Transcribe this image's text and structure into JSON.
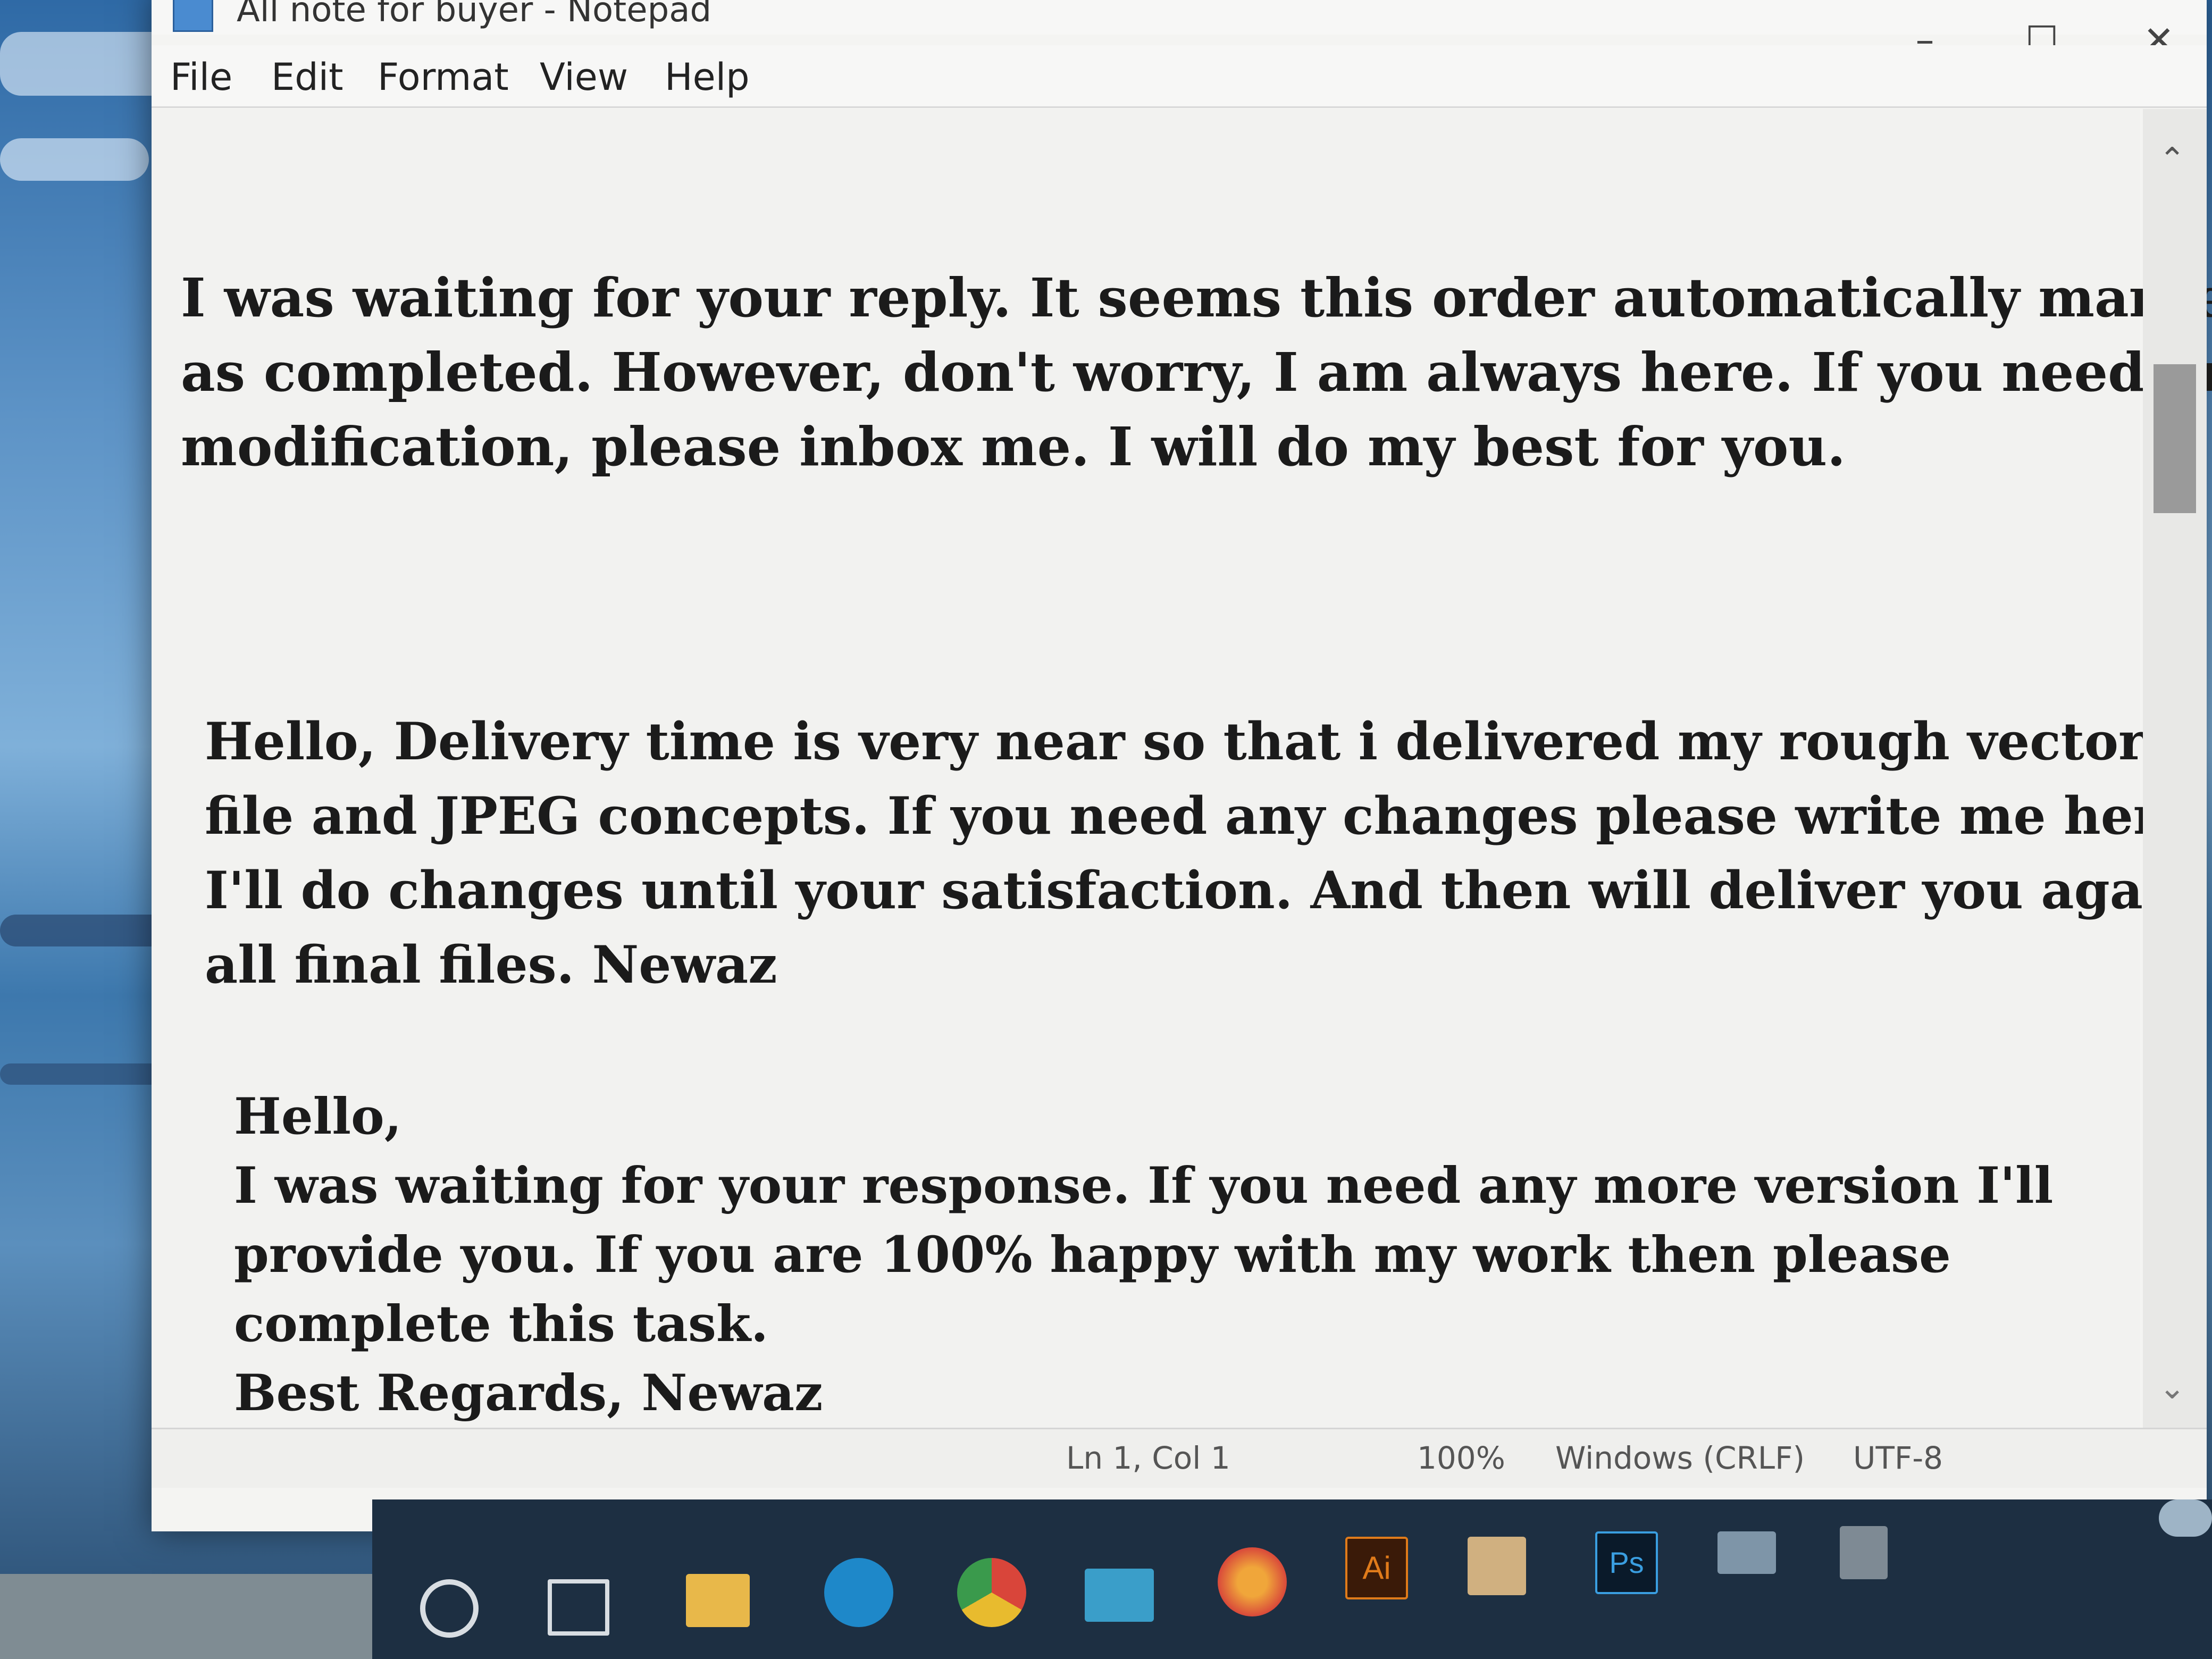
{
  "window": {
    "title": "All note for buyer - Notepad",
    "controls": {
      "minimize": "–",
      "maximize": "☐",
      "close": "✕"
    }
  },
  "menu": {
    "file": "File",
    "edit": "Edit",
    "format": "Format",
    "view": "View",
    "help": "Help"
  },
  "document": {
    "para1": [
      "I was waiting for your reply. It seems this order automatically marked",
      "as completed. However, don't worry, I am always here. If you need any",
      "modification, please inbox me. I will do my best for you."
    ],
    "para2": [
      "Hello, Delivery time is very near so that i delivered my rough vector",
      "file and JPEG concepts. If you need any changes please write me here.",
      "I'll do changes until your satisfaction. And then will deliver you again",
      "all final files. Newaz"
    ],
    "para3": [
      "Hello,",
      "I was waiting for your response. If you need any more version I'll",
      "provide you. If you are 100% happy with my work then please",
      "complete this task.",
      "Best Regards, Newaz"
    ]
  },
  "status": {
    "position": "Ln 1, Col 1",
    "zoom": "100%",
    "line_ending": "Windows (CRLF)",
    "encoding": "UTF-8"
  },
  "taskbar": {
    "icons": [
      "search-circle-icon",
      "task-view-icon",
      "file-explorer-icon",
      "edge-icon",
      "chrome-icon",
      "mail-icon",
      "firefox-icon",
      "illustrator-icon",
      "store-icon",
      "photoshop-icon",
      "folder-icon",
      "app-icon",
      "onedrive-icon"
    ],
    "illustrator_label": "Ai",
    "photoshop_label": "Ps"
  },
  "colors": {
    "window_bg": "#f4f4f2",
    "text": "#1b1b1b",
    "taskbar": "#1d2f42"
  }
}
